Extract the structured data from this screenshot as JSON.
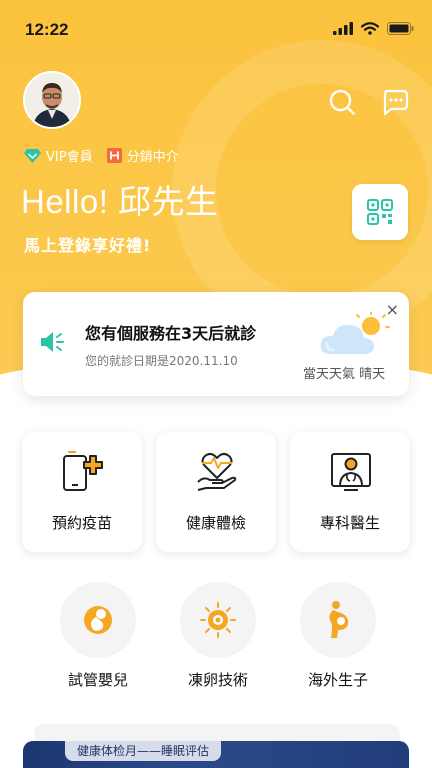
{
  "status": {
    "time": "12:22"
  },
  "header": {
    "vip_label": "VIP會員",
    "distribution_label": "分銷中介",
    "greeting": "Hello! 邱先生",
    "subtitle": "馬上登錄享好禮!"
  },
  "notice": {
    "title": "您有個服務在3天后就診",
    "date_text": "您的就診日期是2020.11.10",
    "weather": "當天天氣 晴天",
    "close": "×"
  },
  "services": [
    {
      "label": "預約疫苗"
    },
    {
      "label": "健康體檢"
    },
    {
      "label": "專科醫生"
    }
  ],
  "features": [
    {
      "label": "試管嬰兒"
    },
    {
      "label": "凍卵技術"
    },
    {
      "label": "海外生子"
    }
  ],
  "banner": {
    "tag": "健康体检月——睡眠评估"
  },
  "colors": {
    "primary": "#FBC23C",
    "teal": "#2CC4A8",
    "orange": "#F5A623",
    "dark": "#1a1a1a"
  }
}
